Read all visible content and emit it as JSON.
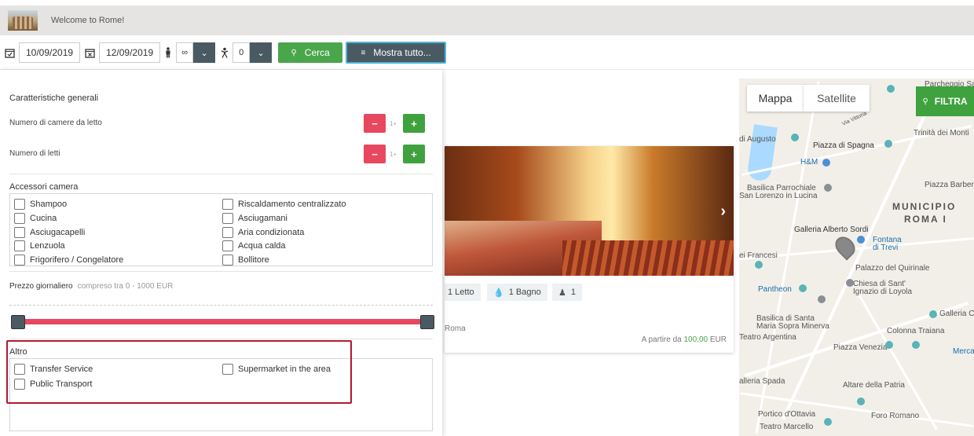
{
  "header": {
    "welcome": "Welcome to Rome!"
  },
  "toolbar": {
    "checkin": "10/09/2019",
    "checkout": "12/09/2019",
    "adults": "∞",
    "children": "0",
    "search_label": "Cerca",
    "show_all_label": "Mostra tutto..."
  },
  "filters": {
    "general_title": "Caratteristiche generali",
    "bedrooms_label": "Numero di camere da letto",
    "bedrooms_value": "1+",
    "beds_label": "Numero di letti",
    "beds_value": "1+",
    "accessories_title": "Accessori camera",
    "accessories": [
      "Shampoo",
      "Cucina",
      "Asciugacapelli",
      "Lenzuola",
      "Frigorifero / Congelatore",
      "Riscaldamento centralizzato",
      "Asciugamani",
      "Aria condizionata",
      "Acqua calda",
      "Bollitore"
    ],
    "price_title": "Prezzo giornaliero",
    "price_range": "compreso tra 0 - 1000 EUR",
    "price_slider": {
      "min": 0,
      "max": 1000
    },
    "other_title": "Altro",
    "other": [
      "Transfer Service",
      "Public Transport",
      "Supermarket in the area"
    ]
  },
  "card": {
    "beds": "1 Letto",
    "baths": "1 Bagno",
    "guests": "1",
    "city": "Roma",
    "price_prefix": "A partire da ",
    "price": "100,00",
    "currency": " EUR"
  },
  "map": {
    "tab_map": "Mappa",
    "tab_satellite": "Satellite",
    "filter_label": "FILTRA",
    "labels": {
      "parchegge": "Parcheggio Saba",
      "augusto": "di Augusto",
      "spagna": "Piazza di Spagna",
      "trinita": "Trinità dei Monti",
      "hm": "H&M",
      "barberini": "Piazza Barberini",
      "basilica": "Basilica Parrochiale",
      "lorenzo": "San Lorenzo in Lucina",
      "municipio": "MUNICIPIO",
      "roma1": "ROMA I",
      "sordi": "Galleria Alberto Sordi",
      "fontana": "Fontana",
      "trevi": "di Trevi",
      "francesi": "ei Francesi",
      "quirinale": "Palazzo del Quirinale",
      "chiesa": "Chiesa di Sant'",
      "ignazio": "Ignazio di Loyola",
      "pantheon": "Pantheon",
      "colonna": "Galleria Colonna",
      "sopra": "Basilica di Santa",
      "minerva": "Maria Sopra Minerva",
      "traiana": "Colonna Traiana",
      "argentina": "Teatro Argentina",
      "venezia": "Piazza Venezia",
      "merca": "Merca",
      "spada": "alleria Spada",
      "altare": "Altare della Patria",
      "ottavia": "Portico d'Ottavia",
      "foro": "Foro Romano",
      "marcello": "Teatro Marcello",
      "vittoria": "Via Vittoria"
    }
  }
}
